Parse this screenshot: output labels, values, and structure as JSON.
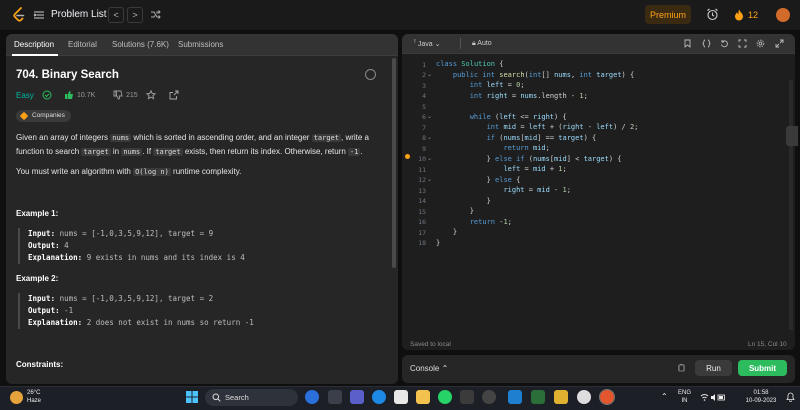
{
  "nav": {
    "title": "Problem List",
    "prev": "<",
    "next": ">",
    "premium": "Premium",
    "streak": "12"
  },
  "left_tabs": [
    "Description",
    "Editorial",
    "Solutions (7.6K)",
    "Submissions"
  ],
  "problem": {
    "title": "704. Binary Search",
    "difficulty": "Easy",
    "likes": "10.7K",
    "dislikes": "215",
    "companies_label": "Companies",
    "desc1_a": "Given an array of integers ",
    "desc1_nums": "nums",
    "desc1_b": " which is sorted in ascending order, and an integer ",
    "desc1_target": "target",
    "desc1_c": ", write a",
    "desc2_a": "function to search ",
    "desc2_target": "target",
    "desc2_b": " in ",
    "desc2_nums": "nums",
    "desc2_c": ". If ",
    "desc2_target2": "target",
    "desc2_d": " exists, then return its index. Otherwise, return ",
    "desc2_neg": "-1",
    "desc2_e": ".",
    "desc3_a": "You must write an algorithm with ",
    "desc3_code": "O(log n)",
    "desc3_b": " runtime complexity.",
    "ex1_title": "Example 1:",
    "ex1_input_label": "Input:",
    "ex1_input": " nums = [-1,0,3,5,9,12], target = 9",
    "ex1_output_label": "Output:",
    "ex1_output": " 4",
    "ex1_expl_label": "Explanation:",
    "ex1_expl": " 9 exists in nums and its index is 4",
    "ex2_title": "Example 2:",
    "ex2_input_label": "Input:",
    "ex2_input": " nums = [-1,0,3,5,9,12], target = 2",
    "ex2_output_label": "Output:",
    "ex2_output": " -1",
    "ex2_expl_label": "Explanation:",
    "ex2_expl": " 2 does not exist in nums so return -1",
    "constraints_title": "Constraints:"
  },
  "editor": {
    "language": "Java",
    "mode": "Auto",
    "saved": "Saved to local",
    "position": "Ln 15, Col 10",
    "line_numbers": [
      "1",
      "2",
      "3",
      "4",
      "5",
      "6",
      "7",
      "8",
      "9",
      "10",
      "11",
      "12",
      "13",
      "14",
      "15",
      "16",
      "17",
      "18"
    ]
  },
  "console": {
    "label": "Console",
    "run": "Run",
    "submit": "Submit"
  },
  "taskbar": {
    "temp": "26°C",
    "weather": "Haze",
    "search": "Search",
    "lang1": "ENG",
    "lang2": "IN",
    "time": "01:58",
    "date": "10-09-2023"
  }
}
